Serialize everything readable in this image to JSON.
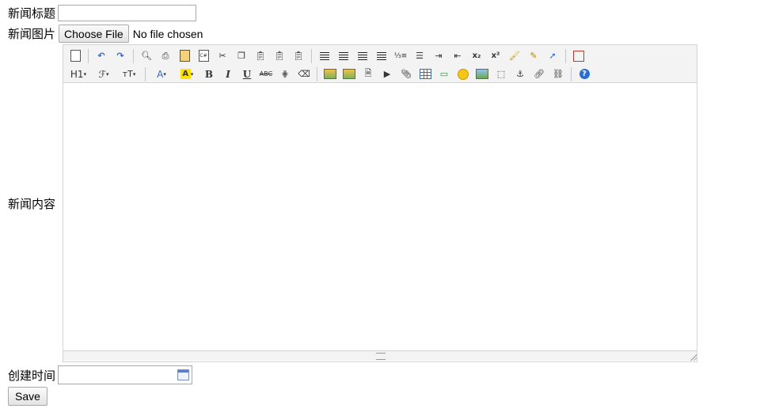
{
  "form": {
    "title_label": "新闻标题",
    "title_value": "",
    "image_label": "新闻图片",
    "file_button": "Choose File",
    "file_status": "No file chosen",
    "content_label": "新闻内容",
    "created_label": "创建时间",
    "created_value": "",
    "save_label": "Save"
  },
  "toolbar": {
    "row1": [
      "source",
      "undo",
      "redo",
      "preview",
      "print",
      "template",
      "code",
      "cut",
      "copy",
      "paste",
      "paste-text",
      "paste-word",
      "align-left",
      "align-center",
      "align-right",
      "justify",
      "ordered-list",
      "unordered-list",
      "indent",
      "outdent",
      "subscript",
      "superscript",
      "clear-format",
      "quick-format",
      "select-all",
      "fullscreen"
    ],
    "row2": {
      "heading": "H1",
      "font_family": "ℱ",
      "font_size": "тT",
      "font_color": "A",
      "highlight": "A",
      "bold": "B",
      "italic": "I",
      "underline": "U",
      "strikethrough": "ABC"
    }
  }
}
